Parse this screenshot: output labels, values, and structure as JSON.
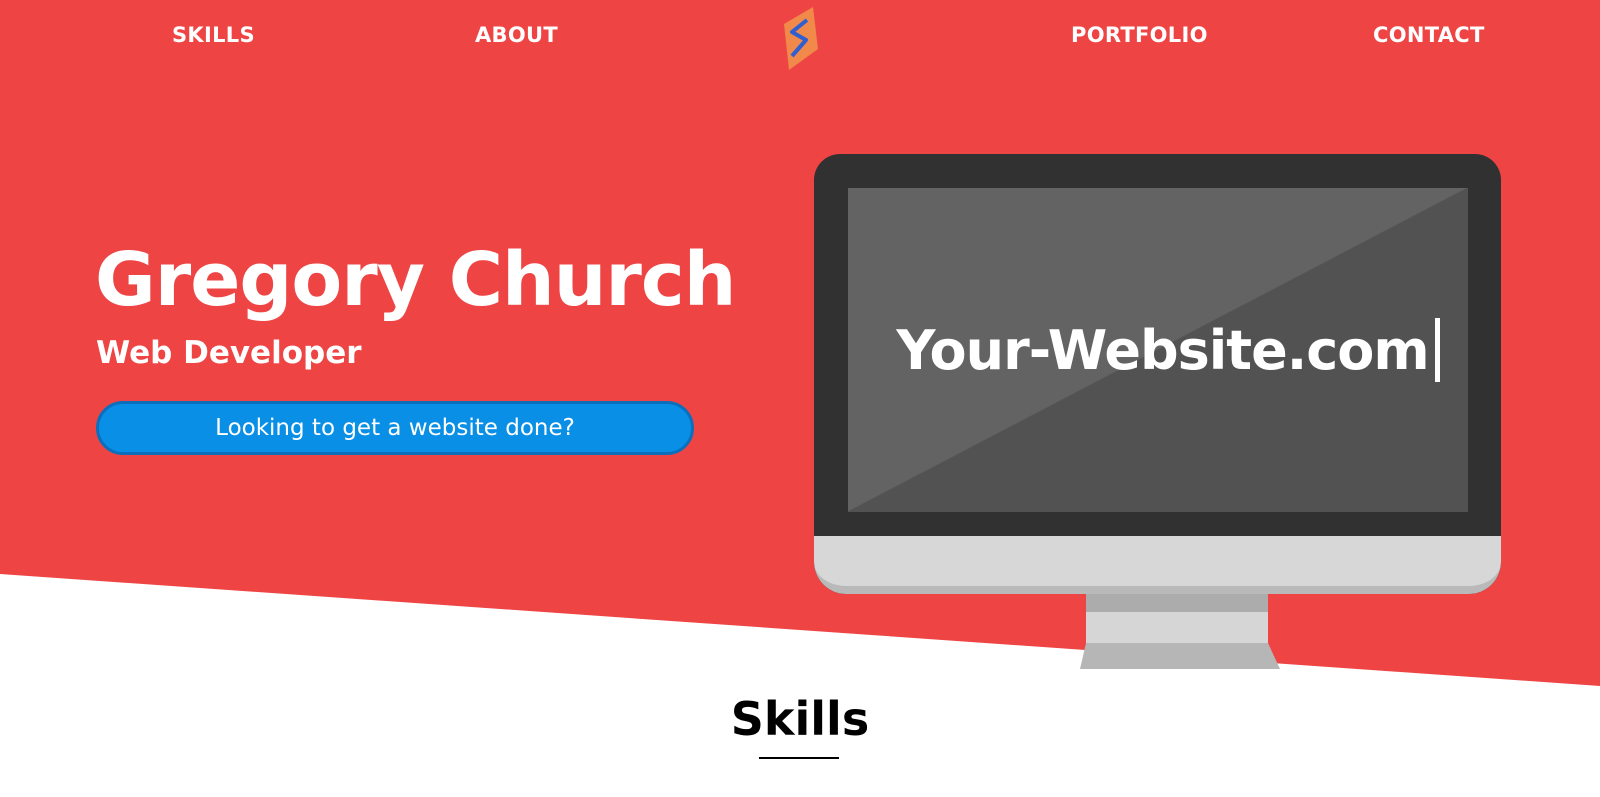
{
  "nav": {
    "items": [
      {
        "label": "SKILLS"
      },
      {
        "label": "ABOUT"
      },
      {
        "label": "PORTFOLIO"
      },
      {
        "label": "CONTACT"
      }
    ],
    "logo_icon": "bracket-s-logo-icon"
  },
  "hero": {
    "name": "Gregory Church",
    "role": "Web Developer",
    "cta_label": "Looking to get a website done?",
    "monitor_text": "Your-Website.com"
  },
  "skills_section": {
    "title": "Skills"
  },
  "colors": {
    "hero_background": "#ef4444",
    "cta_background": "#0a8fe6",
    "monitor_frame": "#313131",
    "text_light": "#ffffff"
  }
}
